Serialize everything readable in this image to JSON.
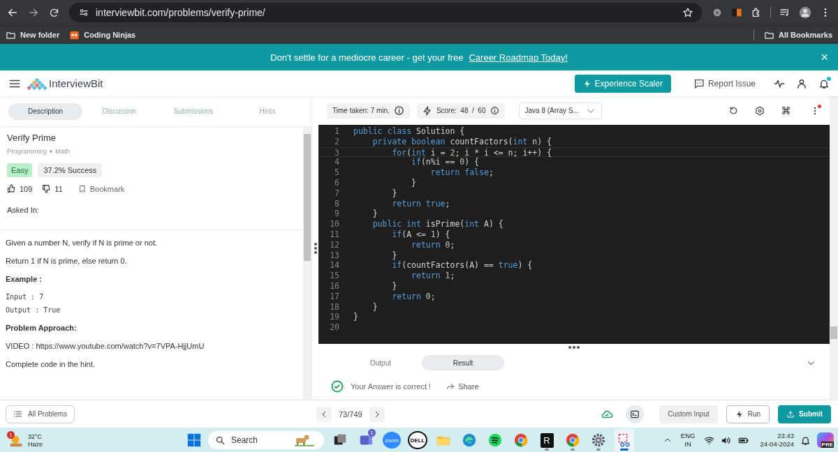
{
  "browser": {
    "url": "interviewbit.com/problems/verify-prime/",
    "bookmarks": [
      {
        "kind": "folder",
        "label": "New folder"
      },
      {
        "kind": "site",
        "label": "Coding Ninjas"
      }
    ],
    "all_bookmarks": "All Bookmarks"
  },
  "banner": {
    "text": "Don't settle for a mediocre career - get your free",
    "link": "Career Roadmap Today!",
    "close": "×"
  },
  "header": {
    "logo": "InterviewBit",
    "cta": "Experience Scaler",
    "report": "Report Issue",
    "notification": true
  },
  "tabs": [
    {
      "label": "Description",
      "selected": true
    },
    {
      "label": "Discussion",
      "selected": false
    },
    {
      "label": "Submissions",
      "selected": false
    },
    {
      "label": "Hints",
      "selected": false
    }
  ],
  "problem": {
    "title": "Verify Prime",
    "topics": [
      "Programming",
      "Math"
    ],
    "difficulty": "Easy",
    "success": "37.2% Success",
    "likes": "109",
    "dislikes": "11",
    "bookmark": "Bookmark",
    "asked_in": "Asked In:",
    "body": [
      {
        "kind": "text",
        "text": "Given a number N, verify if N is prime or not."
      },
      {
        "kind": "text",
        "text": "Return 1 if N is prime, else return 0."
      },
      {
        "kind": "heading",
        "text": "Example :"
      },
      {
        "kind": "code",
        "lines": [
          "Input : 7",
          "Output : True"
        ]
      },
      {
        "kind": "heading",
        "text": "Problem Approach:"
      },
      {
        "kind": "text",
        "text": "VIDEO : https://www.youtube.com/watch?v=7VPA-HjjUmU"
      },
      {
        "kind": "text",
        "text": "Complete code in the hint."
      }
    ]
  },
  "editor": {
    "time": "Time taken: 7 min.",
    "score": "Score:  48  /  60",
    "language": "Java 8 (Array S...",
    "menu_alert": true,
    "lines": [
      {
        "number": "1",
        "active": false,
        "tokens": [
          {
            "kind": "keyword",
            "text": "public class"
          },
          {
            "kind": "plain",
            "text": " Solution {"
          }
        ]
      },
      {
        "number": "2",
        "active": false,
        "tokens": [
          {
            "kind": "keyword",
            "text": "    private boolean"
          },
          {
            "kind": "plain",
            "text": " countFactors("
          },
          {
            "kind": "keyword",
            "text": "int"
          },
          {
            "kind": "plain",
            "text": " n) {"
          }
        ]
      },
      {
        "number": "3",
        "active": true,
        "tokens": [
          {
            "kind": "keyword",
            "text": "        for"
          },
          {
            "kind": "plain",
            "text": "("
          },
          {
            "kind": "keyword",
            "text": "int"
          },
          {
            "kind": "plain",
            "text": " i = "
          },
          {
            "kind": "number",
            "text": "2"
          },
          {
            "kind": "plain",
            "text": "; i * i <= n; i++) {"
          }
        ]
      },
      {
        "number": "4",
        "active": false,
        "tokens": [
          {
            "kind": "keyword",
            "text": "            if"
          },
          {
            "kind": "plain",
            "text": "(n%i == "
          },
          {
            "kind": "number",
            "text": "0"
          },
          {
            "kind": "plain",
            "text": ") {"
          }
        ]
      },
      {
        "number": "5",
        "active": false,
        "tokens": [
          {
            "kind": "keyword",
            "text": "                return false"
          },
          {
            "kind": "plain",
            "text": ";"
          }
        ]
      },
      {
        "number": "6",
        "active": false,
        "tokens": [
          {
            "kind": "plain",
            "text": "            }"
          }
        ]
      },
      {
        "number": "7",
        "active": false,
        "tokens": [
          {
            "kind": "plain",
            "text": "        }"
          }
        ]
      },
      {
        "number": "8",
        "active": false,
        "tokens": [
          {
            "kind": "keyword",
            "text": "        return true"
          },
          {
            "kind": "plain",
            "text": ";"
          }
        ]
      },
      {
        "number": "9",
        "active": false,
        "tokens": [
          {
            "kind": "plain",
            "text": "    }"
          }
        ]
      },
      {
        "number": "10",
        "active": false,
        "tokens": [
          {
            "kind": "keyword",
            "text": "    public int"
          },
          {
            "kind": "plain",
            "text": " isPrime("
          },
          {
            "kind": "keyword",
            "text": "int"
          },
          {
            "kind": "plain",
            "text": " A) {"
          }
        ]
      },
      {
        "number": "11",
        "active": false,
        "tokens": [
          {
            "kind": "keyword",
            "text": "        if"
          },
          {
            "kind": "plain",
            "text": "(A <= "
          },
          {
            "kind": "number",
            "text": "1"
          },
          {
            "kind": "plain",
            "text": ") {"
          }
        ]
      },
      {
        "number": "12",
        "active": false,
        "tokens": [
          {
            "kind": "keyword",
            "text": "            return "
          },
          {
            "kind": "number",
            "text": "0"
          },
          {
            "kind": "plain",
            "text": ";"
          }
        ]
      },
      {
        "number": "13",
        "active": false,
        "tokens": [
          {
            "kind": "plain",
            "text": "        }"
          }
        ]
      },
      {
        "number": "14",
        "active": false,
        "tokens": [
          {
            "kind": "keyword",
            "text": "        if"
          },
          {
            "kind": "plain",
            "text": "(countFactors(A) == "
          },
          {
            "kind": "keyword",
            "text": "true"
          },
          {
            "kind": "plain",
            "text": ") {"
          }
        ]
      },
      {
        "number": "15",
        "active": false,
        "tokens": [
          {
            "kind": "keyword",
            "text": "            return "
          },
          {
            "kind": "number",
            "text": "1"
          },
          {
            "kind": "plain",
            "text": ";"
          }
        ]
      },
      {
        "number": "16",
        "active": false,
        "tokens": [
          {
            "kind": "plain",
            "text": "        }"
          }
        ]
      },
      {
        "number": "17",
        "active": false,
        "tokens": [
          {
            "kind": "keyword",
            "text": "        return "
          },
          {
            "kind": "number",
            "text": "0"
          },
          {
            "kind": "plain",
            "text": ";"
          }
        ]
      },
      {
        "number": "18",
        "active": false,
        "tokens": [
          {
            "kind": "plain",
            "text": "    }"
          }
        ]
      },
      {
        "number": "19",
        "active": false,
        "tokens": [
          {
            "kind": "plain",
            "text": "}"
          }
        ]
      },
      {
        "number": "20",
        "active": false
      }
    ]
  },
  "console": {
    "tabs": [
      {
        "label": "Output",
        "selected": false
      },
      {
        "label": "Result",
        "selected": true
      }
    ],
    "message": "Your Answer is correct !",
    "share": "Share"
  },
  "footer": {
    "all_problems": "All Problems",
    "position": "73/749",
    "custom_input": "Custom Input",
    "run": "Run",
    "submit": "Submit"
  },
  "taskbar": {
    "weather": {
      "badge": "1",
      "temp": "32°C",
      "condition": "Haze"
    },
    "search": {
      "placeholder": "Search"
    },
    "apps": [
      {
        "kind": "taskview",
        "running": false
      },
      {
        "kind": "teams",
        "badge": "1",
        "running": false
      },
      {
        "kind": "zoom",
        "label": "zoom",
        "running": false
      },
      {
        "kind": "dell",
        "label": "DELL",
        "running": false
      },
      {
        "kind": "folder",
        "running": false
      },
      {
        "kind": "edge",
        "running": false
      },
      {
        "kind": "spotify",
        "running": false
      },
      {
        "kind": "chrome",
        "running": false
      },
      {
        "kind": "letter",
        "label": "R",
        "running": true
      },
      {
        "kind": "chrome",
        "running": true
      },
      {
        "kind": "settings",
        "running": true
      },
      {
        "kind": "snip",
        "running": true
      }
    ],
    "lang": "ENG",
    "region": "IN",
    "time": "23:43",
    "date": "24-04-2024",
    "copilot": "PRE"
  }
}
